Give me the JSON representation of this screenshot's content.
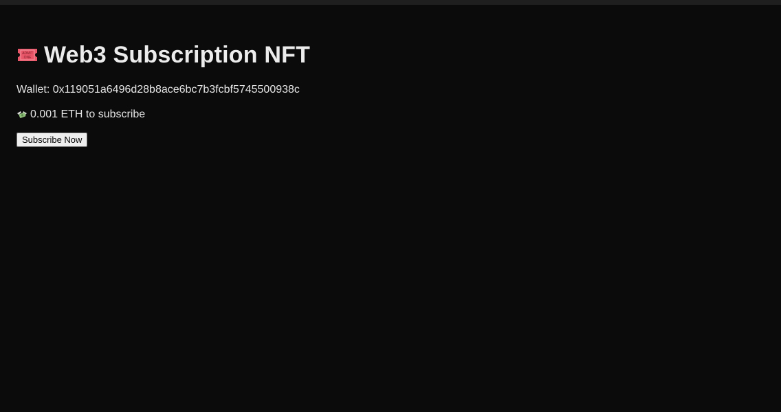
{
  "header": {
    "title": "Web3 Subscription NFT",
    "title_icon": "admission-ticket-icon",
    "ticket_icon_text_line1": "ADMIT",
    "ticket_icon_text_line2": "ONE"
  },
  "wallet": {
    "label": "Wallet:",
    "address": "0x119051a6496d28b8ace6bc7b3fcbf5745500938c"
  },
  "price": {
    "icon": "money-with-wings-icon",
    "text": "0.001 ETH to subscribe"
  },
  "actions": {
    "subscribe_label": "Subscribe Now"
  },
  "colors": {
    "background": "#0b0b0b",
    "text": "#e6e6e6",
    "ticket": "#e8586a"
  }
}
